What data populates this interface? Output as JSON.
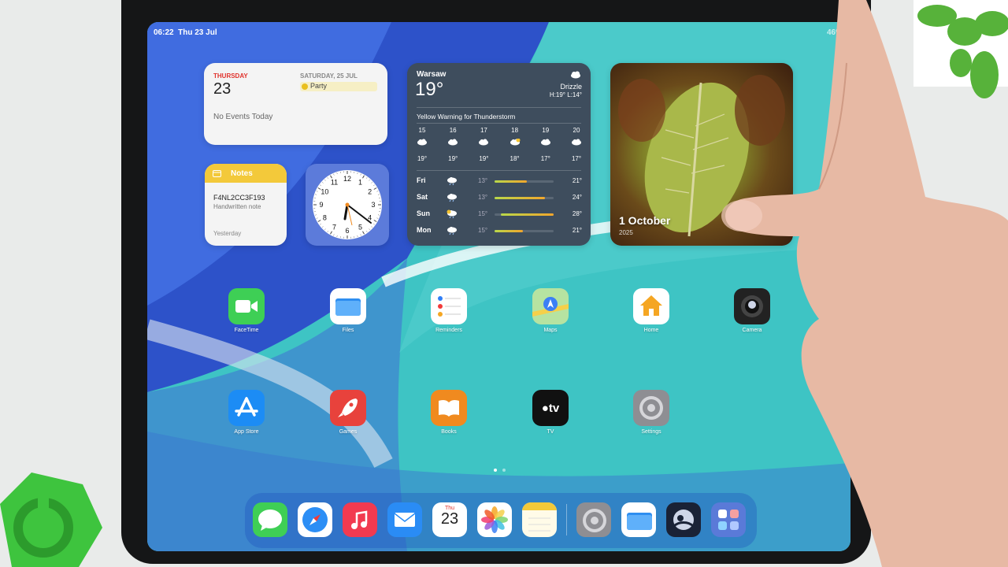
{
  "status_bar": {
    "time": "06:22",
    "date": "Thu 23 Jul",
    "right_indicator": "46%"
  },
  "calendar_widget": {
    "today_label": "THURSDAY",
    "today_number": "23",
    "no_events": "No Events Today",
    "next_day_label": "SATURDAY, 25 JUL",
    "next_event": "Party"
  },
  "notes_widget": {
    "header": "Notes",
    "title": "F4NL2CC3F193",
    "subtitle": "Handwritten note",
    "footer": "Yesterday"
  },
  "clock_widget": {
    "numbers": [
      "12",
      "1",
      "2",
      "3",
      "4",
      "5",
      "6",
      "7",
      "8",
      "9",
      "10",
      "11"
    ]
  },
  "weather_widget": {
    "city": "Warsaw",
    "temperature": "19°",
    "condition": "Drizzle",
    "high_low": "H:19° L:14°",
    "warning": "Yellow Warning for Thunderstorm",
    "hourly": [
      {
        "hour": "15",
        "temp": "19°"
      },
      {
        "hour": "16",
        "temp": "19°"
      },
      {
        "hour": "17",
        "temp": "19°"
      },
      {
        "hour": "18",
        "temp": "18°"
      },
      {
        "hour": "19",
        "temp": "17°"
      },
      {
        "hour": "20",
        "temp": "17°"
      }
    ],
    "daily": [
      {
        "day": "Fri",
        "low": "13°",
        "high": "21°"
      },
      {
        "day": "Sat",
        "low": "13°",
        "high": "24°"
      },
      {
        "day": "Sun",
        "low": "15°",
        "high": "28°"
      },
      {
        "day": "Mon",
        "low": "15°",
        "high": "21°"
      }
    ]
  },
  "photo_widget": {
    "date": "1 October",
    "year": "2025"
  },
  "apps": [
    {
      "label": "FaceTime",
      "icon": "facetime-icon",
      "color": "#3ecf55"
    },
    {
      "label": "Files",
      "icon": "folder-icon",
      "color": "#ffffff"
    },
    {
      "label": "Reminders",
      "icon": "list-icon",
      "color": "#ffffff"
    },
    {
      "label": "Maps",
      "icon": "map-icon",
      "color": "#b6e3a1"
    },
    {
      "label": "Home",
      "icon": "house-icon",
      "color": "#ffffff"
    },
    {
      "label": "Camera",
      "icon": "camera-icon",
      "color": "#222222"
    },
    {
      "label": "App Store",
      "icon": "appstore-icon",
      "color": "#1c8cf5"
    },
    {
      "label": "Games",
      "icon": "rocket-icon",
      "color": "#e8423c"
    },
    {
      "label": "Books",
      "icon": "book-icon",
      "color": "#f08a1f"
    },
    {
      "label": "TV",
      "icon": "appletv-icon",
      "color": "#111111"
    },
    {
      "label": "Settings",
      "icon": "gear-icon",
      "color": "#8e8e93"
    }
  ],
  "dock": [
    {
      "name": "messages",
      "icon": "message-icon",
      "color": "#3fcf55"
    },
    {
      "name": "safari",
      "icon": "compass-icon",
      "color": "#ffffff"
    },
    {
      "name": "music",
      "icon": "music-note-icon",
      "color": "#f23a50"
    },
    {
      "name": "mail",
      "icon": "envelope-icon",
      "color": "#2a8cf5"
    },
    {
      "name": "calendar",
      "icon": "calendar-icon",
      "color": "#ffffff",
      "text_top": "Thu",
      "text": "23"
    },
    {
      "name": "photos",
      "icon": "photos-flower-icon",
      "color": "#ffffff"
    },
    {
      "name": "notes",
      "icon": "notes-icon",
      "color": "#fffbe8"
    },
    {
      "name": "settings",
      "icon": "gear-icon",
      "color": "#8e8e93"
    },
    {
      "name": "files",
      "icon": "folder-icon",
      "color": "#ffffff"
    },
    {
      "name": "preview",
      "icon": "preview-icon",
      "color": "#1a2236"
    },
    {
      "name": "app-library",
      "icon": "app-library-icon",
      "color": "#5a7ad8"
    }
  ]
}
